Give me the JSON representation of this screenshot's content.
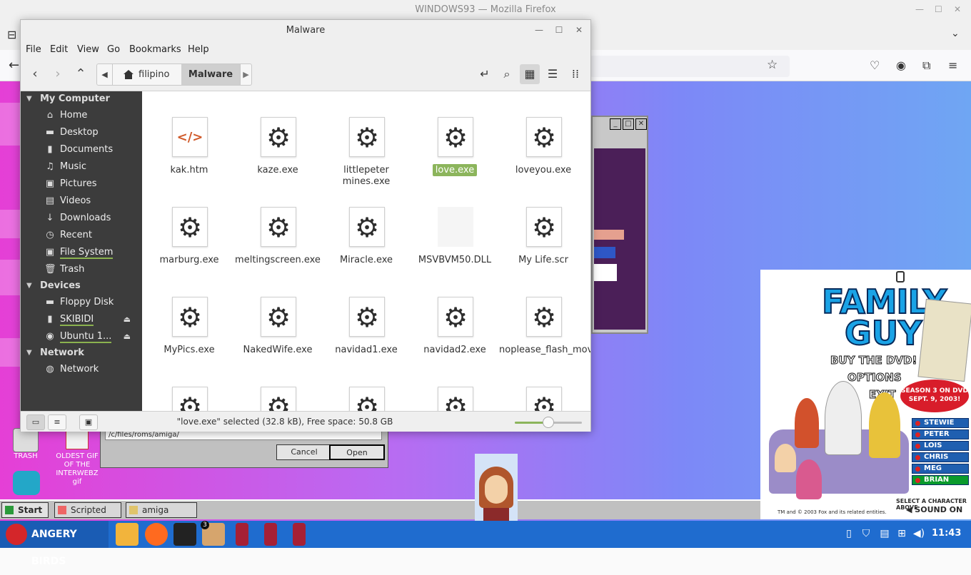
{
  "firefox": {
    "window_title": "WINDOWS93 — Mozilla Firefox",
    "win_min": "—",
    "win_max": "☐",
    "win_close": "✕"
  },
  "win93": {
    "desktop_labels": {
      "trash": "TRASH",
      "gif": "OLDEST GIF OF THE INTERWEBZ gif"
    },
    "dialog": {
      "path": "/c/files/roms/amiga/",
      "cancel": "Cancel",
      "open": "Open"
    },
    "taskbar": {
      "start": "Start",
      "task1": "Scripted A...",
      "task2": "amiga"
    },
    "family_guy": {
      "logo_line1": "FAMILY",
      "logo_line2": "GUY",
      "menu": [
        "BUY THE DVD!",
        "OPTIONS",
        "EXIT"
      ],
      "season": "SEASON 3 ON DVD SEPT. 9, 2003!",
      "characters": [
        "STEWIE",
        "PETER",
        "LOIS",
        "CHRIS",
        "MEG",
        "BRIAN"
      ],
      "select_text": "SELECT A CHARACTER ABOVE",
      "tm_text": "TM and © 2003 Fox and its related entities.",
      "sound": "SOUND ON"
    }
  },
  "panel": {
    "menu_label": "ANGERY BIRDS",
    "badge": "3",
    "clock": "11:43"
  },
  "nemo": {
    "title": "Malware",
    "menu": [
      "File",
      "Edit",
      "View",
      "Go",
      "Bookmarks",
      "Help"
    ],
    "breadcrumb": {
      "home": "filipino",
      "current": "Malware"
    },
    "sidebar": {
      "my_computer": "My Computer",
      "places": [
        {
          "label": "Home",
          "icon": "home-icon"
        },
        {
          "label": "Desktop",
          "icon": "desktop-icon"
        },
        {
          "label": "Documents",
          "icon": "documents-icon"
        },
        {
          "label": "Music",
          "icon": "music-icon"
        },
        {
          "label": "Pictures",
          "icon": "pictures-icon"
        },
        {
          "label": "Videos",
          "icon": "videos-icon"
        },
        {
          "label": "Downloads",
          "icon": "downloads-icon"
        },
        {
          "label": "Recent",
          "icon": "recent-icon"
        },
        {
          "label": "File System",
          "icon": "drive-icon"
        },
        {
          "label": "Trash",
          "icon": "trash-icon"
        }
      ],
      "devices_header": "Devices",
      "devices": [
        {
          "label": "Floppy Disk",
          "icon": "floppy-icon"
        },
        {
          "label": "SKIBIDI",
          "icon": "usb-icon"
        },
        {
          "label": "Ubuntu 1...",
          "icon": "disc-icon"
        }
      ],
      "network_header": "Network",
      "network": [
        {
          "label": "Network",
          "icon": "network-icon"
        }
      ]
    },
    "files": [
      {
        "name": "kak.htm",
        "type": "html"
      },
      {
        "name": "kaze.exe",
        "type": "exe"
      },
      {
        "name": "littlepeter mines.exe",
        "type": "exe"
      },
      {
        "name": "love.exe",
        "type": "exe",
        "selected": true
      },
      {
        "name": "loveyou.exe",
        "type": "exe"
      },
      {
        "name": "marburg.exe",
        "type": "exe"
      },
      {
        "name": "meltingscreen.exe",
        "type": "exe"
      },
      {
        "name": "Miracle.exe",
        "type": "exe"
      },
      {
        "name": "MSVBVM50.DLL",
        "type": "dll"
      },
      {
        "name": "My Life.scr",
        "type": "exe"
      },
      {
        "name": "MyPics.exe",
        "type": "exe"
      },
      {
        "name": "NakedWife.exe",
        "type": "exe"
      },
      {
        "name": "navidad1.exe",
        "type": "exe"
      },
      {
        "name": "navidad2.exe",
        "type": "exe"
      },
      {
        "name": "noplease_flash_movie.exe",
        "type": "exe"
      },
      {
        "name": "",
        "type": "exe"
      },
      {
        "name": "",
        "type": "exe"
      },
      {
        "name": "",
        "type": "exe"
      },
      {
        "name": "",
        "type": "exe"
      },
      {
        "name": "",
        "type": "exe"
      }
    ],
    "status": "\"love.exe\" selected (32.8 kB), Free space: 50.8 GB",
    "zoom_level": 0.5,
    "accent_color": "#8cb55c"
  }
}
